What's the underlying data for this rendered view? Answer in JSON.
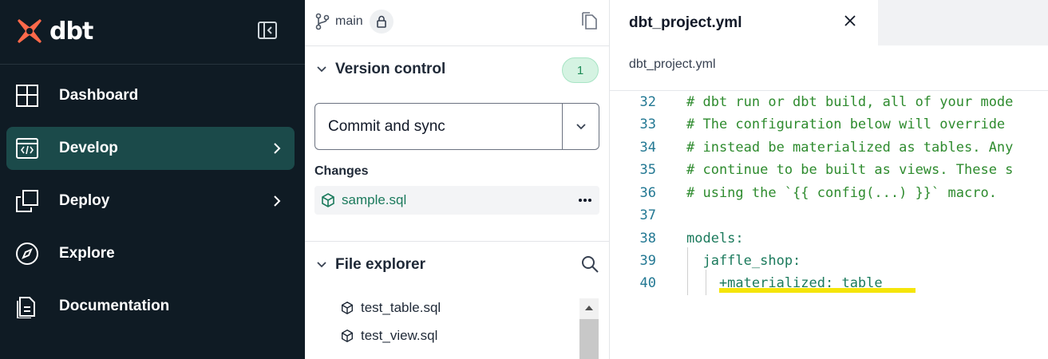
{
  "app": {
    "brand": "dbt",
    "colors": {
      "sidebar_bg": "#0f1b24",
      "active_nav": "#1b4a4a",
      "accent": "#ff694a",
      "badge_green": "#1b8a55"
    }
  },
  "sidebar": {
    "items": [
      {
        "label": "Dashboard",
        "icon": "dashboard-icon",
        "active": false,
        "chevron": false
      },
      {
        "label": "Develop",
        "icon": "code-icon",
        "active": true,
        "chevron": true
      },
      {
        "label": "Deploy",
        "icon": "deploy-icon",
        "active": false,
        "chevron": true
      },
      {
        "label": "Explore",
        "icon": "compass-icon",
        "active": false,
        "chevron": false
      },
      {
        "label": "Documentation",
        "icon": "docs-icon",
        "active": false,
        "chevron": false
      }
    ]
  },
  "git": {
    "branch": "main",
    "version_control": {
      "title": "Version control",
      "count": "1",
      "commit_label": "Commit and sync"
    },
    "changes": {
      "label": "Changes",
      "items": [
        {
          "name": "sample.sql"
        }
      ]
    }
  },
  "file_explorer": {
    "title": "File explorer",
    "files": [
      {
        "name": "test_table.sql"
      },
      {
        "name": "test_view.sql"
      }
    ]
  },
  "editor": {
    "tab_title": "dbt_project.yml",
    "breadcrumb": "dbt_project.yml",
    "lines": [
      {
        "n": "32",
        "text": "# dbt run or dbt build, all of your mode",
        "kind": "comment"
      },
      {
        "n": "33",
        "text": "# The configuration below will override",
        "kind": "comment"
      },
      {
        "n": "34",
        "text": "# instead be materialized as tables. Any",
        "kind": "comment"
      },
      {
        "n": "35",
        "text": "# continue to be built as views. These s",
        "kind": "comment"
      },
      {
        "n": "36",
        "text": "# using the `{{ config(...) }}` macro.",
        "kind": "comment"
      },
      {
        "n": "37",
        "text": "",
        "kind": "plain"
      },
      {
        "n": "38",
        "text": "models:",
        "kind": "key"
      },
      {
        "n": "39",
        "text": "  jaffle_shop:",
        "kind": "key"
      },
      {
        "n": "40",
        "text": "    +materialized: table",
        "kind": "key"
      }
    ]
  }
}
